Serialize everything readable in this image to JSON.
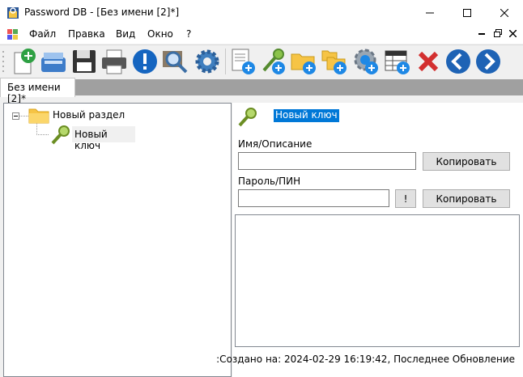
{
  "window": {
    "title": "Password DB - [Без имени [2]*]"
  },
  "menu": {
    "file": "Файл",
    "edit": "Правка",
    "view": "Вид",
    "window": "Окно",
    "help": "?"
  },
  "toolbar": {
    "buttons": [
      "new-document",
      "open",
      "save",
      "print",
      "info",
      "search",
      "settings",
      "new-page",
      "new-key",
      "new-folder",
      "new-subfolder",
      "sync-add",
      "table-add",
      "delete",
      "back",
      "forward"
    ]
  },
  "tab": {
    "label": "Без имени [2]*"
  },
  "tree": {
    "section_label": "Новый раздел",
    "key_label": "Новый ключ"
  },
  "detail": {
    "key_title": "Новый ключ",
    "name_label": "Имя/Описание",
    "name_value": "",
    "copy1": "Копировать",
    "password_label": "Пароль/ПИН",
    "password_value": "",
    "show_btn": "!",
    "copy2": "Копировать",
    "notes": "",
    "status": ":Создано на: 2024-02-29 16:19:42, Последнее Обновление"
  },
  "colors": {
    "accent": "#0078d7",
    "selection": "#0078d7"
  }
}
